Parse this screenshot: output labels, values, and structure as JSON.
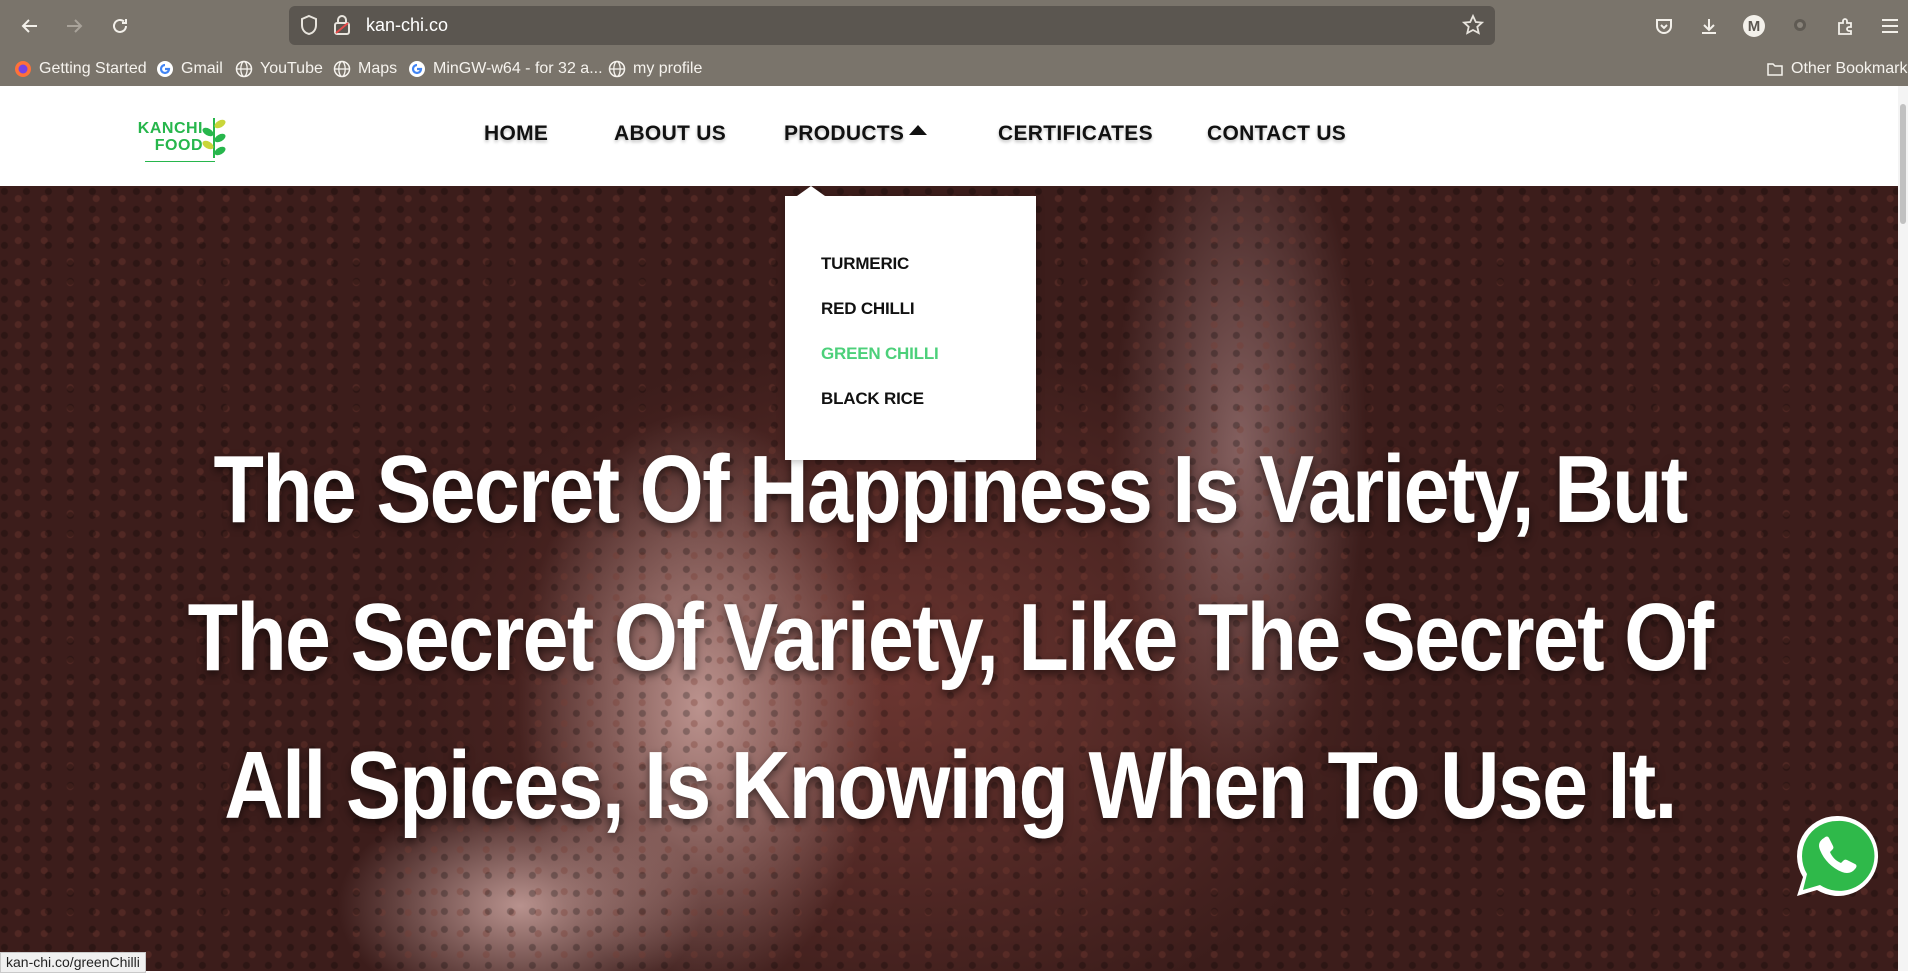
{
  "browser": {
    "url": "kan-chi.co",
    "status_url": "kan-chi.co/greenChilli",
    "profile_initial": "M",
    "bookmarks": [
      {
        "label": "Getting Started",
        "icon": "firefox-icon"
      },
      {
        "label": "Gmail",
        "icon": "google-icon"
      },
      {
        "label": "YouTube",
        "icon": "globe-icon"
      },
      {
        "label": "Maps",
        "icon": "globe-icon"
      },
      {
        "label": "MinGW-w64 - for 32 a...",
        "icon": "google-icon"
      },
      {
        "label": "my profile",
        "icon": "globe-icon"
      }
    ],
    "other_bookmarks": "Other Bookmarks"
  },
  "site": {
    "logo_line1": "KANCHI",
    "logo_line2": "FOOD",
    "menu": {
      "home": "HOME",
      "about": "ABOUT US",
      "products": "PRODUCTS",
      "certificates": "CERTIFICATES",
      "contact": "CONTACT US"
    },
    "products_dropdown": [
      "TURMERIC",
      "RED CHILLI",
      "GREEN CHILLI",
      "BLACK RICE"
    ],
    "active_dropdown_item": "GREEN CHILLI"
  },
  "hero": {
    "quote": "The Secret Of Happiness Is Variety, But The Secret Of Variety, Like The Secret Of All Spices, Is Knowing When To Use It."
  },
  "colors": {
    "brand_green": "#27b64c",
    "hover_green": "#4cd07a",
    "whatsapp": "#2fb94a"
  }
}
